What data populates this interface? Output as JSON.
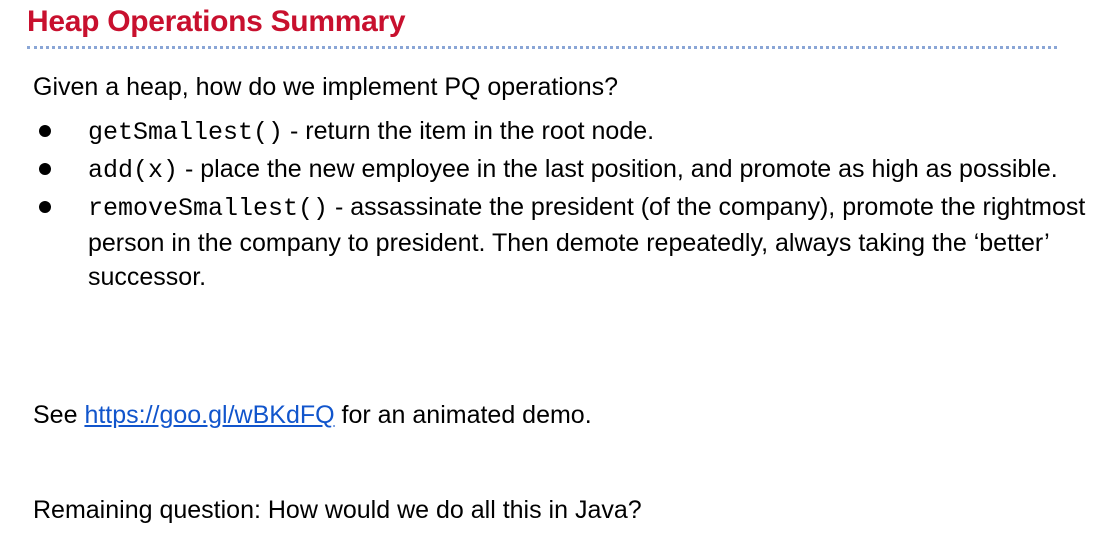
{
  "title": "Heap Operations Summary",
  "intro": "Given a heap, how do we implement PQ operations?",
  "bullets": [
    {
      "code": "getSmallest()",
      "text": " - return the item in the root node."
    },
    {
      "code": "add(x)",
      "text": " - place the new employee in the last position, and promote as high as possible."
    },
    {
      "code": "removeSmallest()",
      "text": " - assassinate the president (of the company), promote the rightmost person in the company to president. Then demote repeatedly, always taking the ‘better’ successor."
    }
  ],
  "demo": {
    "prefix": "See ",
    "link_text": "https://goo.gl/wBKdFQ",
    "suffix": " for an animated demo."
  },
  "question": "Remaining question: How would we do all this in Java?",
  "colors": {
    "title": "#c8102e",
    "title_rule": "#8aa6d6",
    "link": "#1155cc",
    "text": "#000000"
  }
}
